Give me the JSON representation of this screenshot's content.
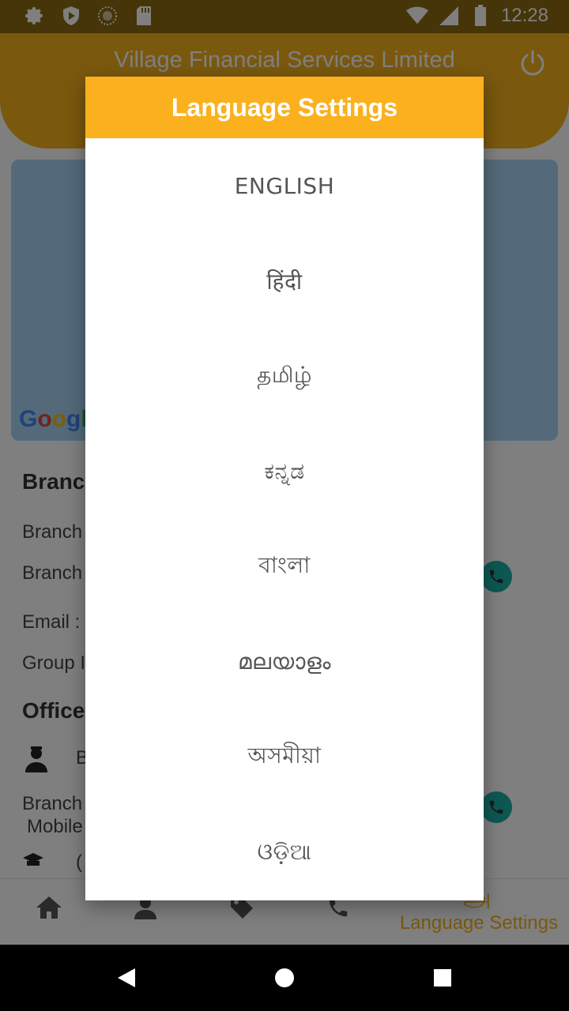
{
  "status_bar": {
    "time": "12:28",
    "icons_left": [
      "gear-icon",
      "shield-play-icon",
      "circle-icon",
      "sd-card-icon"
    ],
    "icons_right": [
      "wifi-icon",
      "signal-icon",
      "battery-icon"
    ]
  },
  "app": {
    "title": "Village Financial Services Limited",
    "map_logo": "Google",
    "info": {
      "branch_heading": "Branc",
      "branch_line1": "Branch",
      "branch_line2": "Branch",
      "email": "Email :",
      "group": "Group I",
      "officer_heading": "Office",
      "officer_name": "B",
      "branch_mobile_1": "Branch",
      "branch_mobile_2": "Mobile",
      "partial_text": "("
    },
    "bottom_nav": {
      "language_label": "Language Settings"
    }
  },
  "dialog": {
    "title": "Language Settings",
    "languages": [
      "ENGLISH",
      "हिंदी",
      "தமிழ்",
      "ಕನ್ನಡ",
      "বাংলা",
      "മലയാളം",
      "অসমীয়া",
      "ଓଡ଼ିଆ"
    ]
  },
  "colors": {
    "accent": "#fbb01d",
    "header_bg": "#f5b11c",
    "call_button": "#1ab0a6"
  }
}
